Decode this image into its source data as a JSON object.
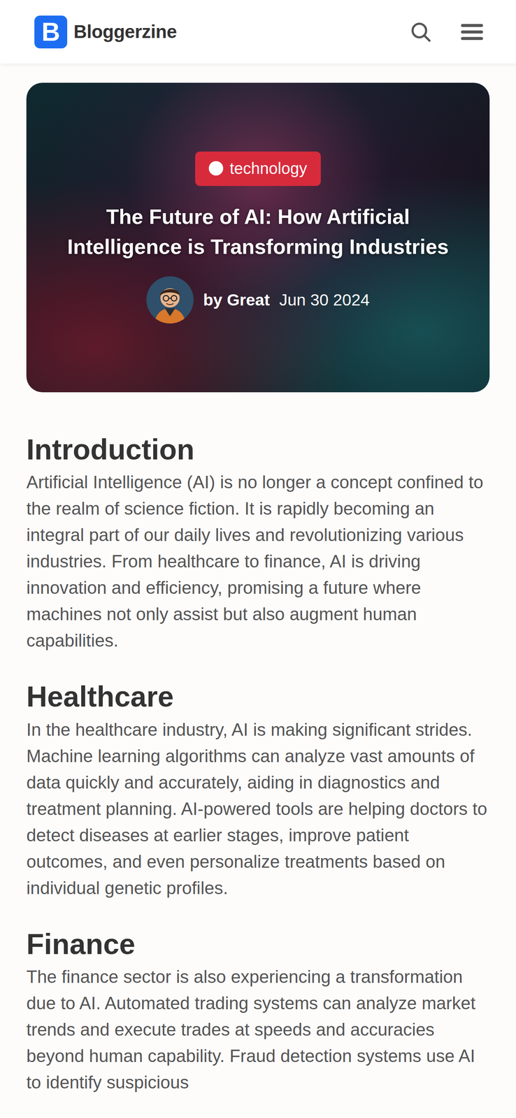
{
  "header": {
    "logo_letter": "B",
    "brand": "Bloggerzine"
  },
  "hero": {
    "category": "technology",
    "title": "The Future of AI: How Artificial Intelligence is Transforming Industries",
    "author": "by Great",
    "date": "Jun 30 2024"
  },
  "sections": [
    {
      "heading": "Introduction",
      "body": "Artificial Intelligence (AI) is no longer a concept confined to the realm of science fiction. It is rapidly becoming an integral part of our daily lives and revolutionizing various industries. From healthcare to finance, AI is driving innovation and efficiency, promising a future where machines not only assist but also augment human capabilities."
    },
    {
      "heading": "Healthcare",
      "body": "In the healthcare industry, AI is making significant strides. Machine learning algorithms can analyze vast amounts of data quickly and accurately, aiding in diagnostics and treatment planning. AI-powered tools are helping doctors to detect diseases at earlier stages, improve patient outcomes, and even personalize treatments based on individual genetic profiles."
    },
    {
      "heading": "Finance",
      "body": "The finance sector is also experiencing a transformation due to AI. Automated trading systems can analyze market trends and execute trades at speeds and accuracies beyond human capability. Fraud detection systems use AI to identify suspicious"
    }
  ]
}
